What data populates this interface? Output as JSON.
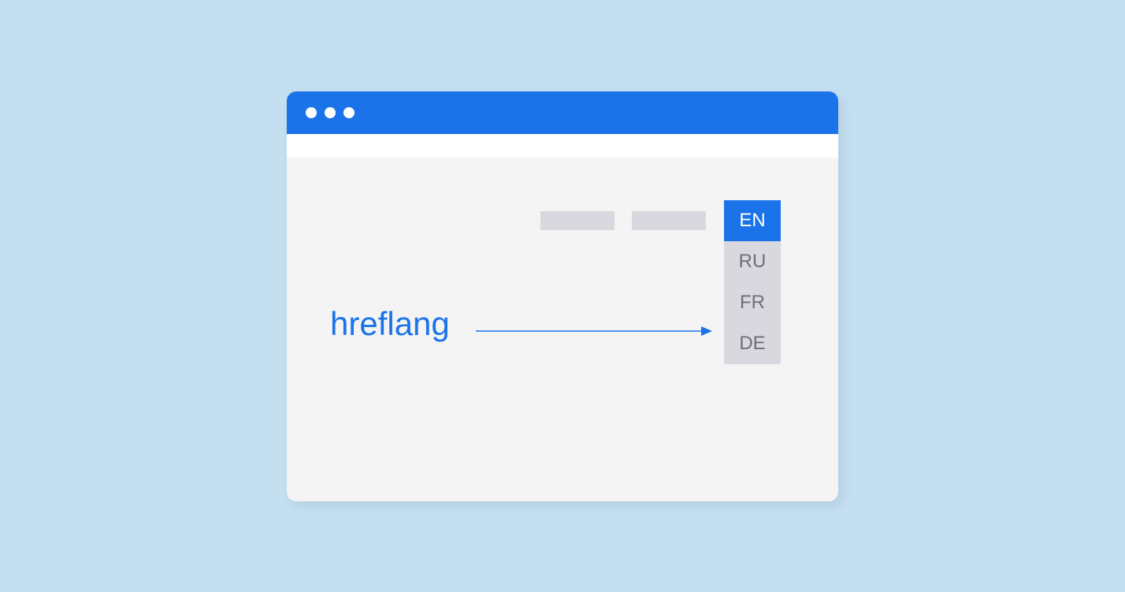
{
  "colors": {
    "background": "#c3dff0",
    "accent": "#1a73e8",
    "window_bg": "#f4f4f4",
    "placeholder": "#d8d8de",
    "text_muted": "#6e6e76"
  },
  "main_label": "hreflang",
  "language_dropdown": {
    "selected": "EN",
    "options": [
      "EN",
      "RU",
      "FR",
      "DE"
    ]
  }
}
